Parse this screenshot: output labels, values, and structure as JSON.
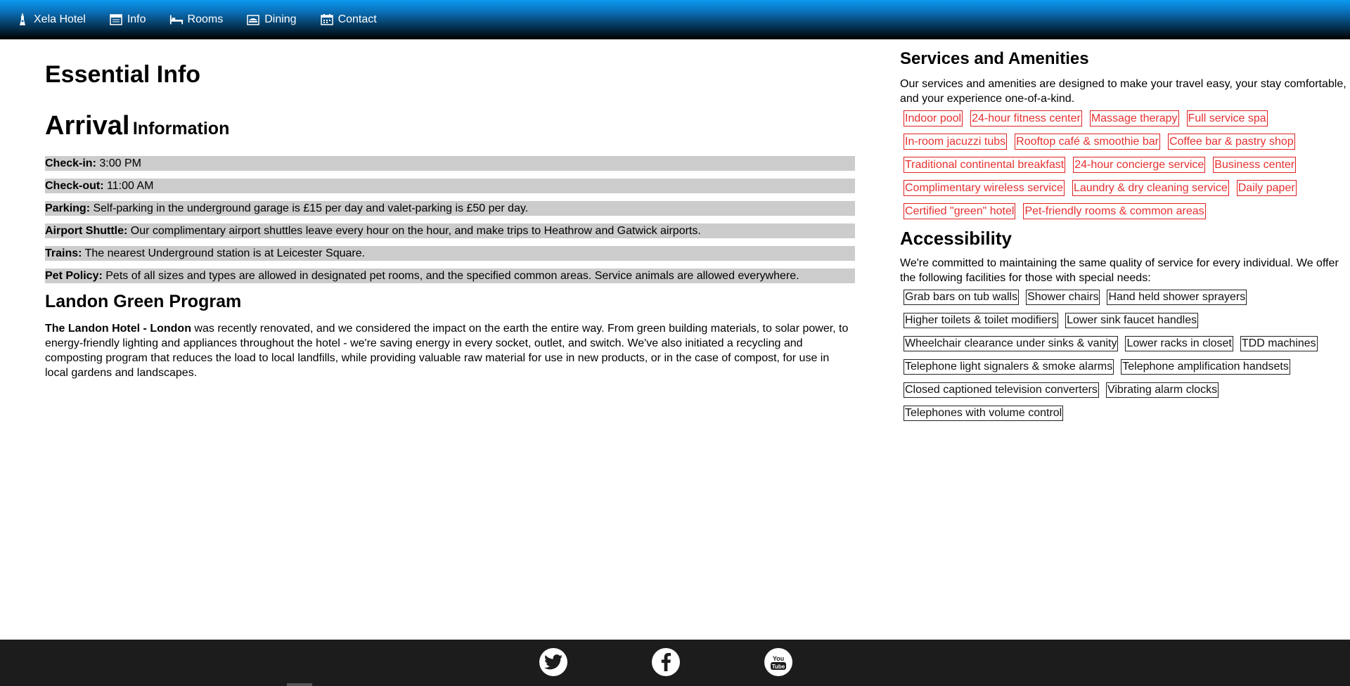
{
  "nav": {
    "brand": {
      "label": "Xela Hotel",
      "icon": "tower-icon"
    },
    "items": [
      {
        "label": "Info",
        "icon": "info-icon"
      },
      {
        "label": "Rooms",
        "icon": "bed-icon"
      },
      {
        "label": "Dining",
        "icon": "dining-icon"
      },
      {
        "label": "Contact",
        "icon": "contact-icon"
      }
    ]
  },
  "essential": {
    "title": "Essential Info",
    "arrival_big": "Arrival",
    "arrival_small": "Information",
    "rows": [
      {
        "label": "Check-in:",
        "text": " 3:00 PM"
      },
      {
        "label": "Check-out:",
        "text": " 11:00 AM"
      },
      {
        "label": "Parking:",
        "text": " Self-parking in the underground garage is £15 per day and valet-parking is £50 per day."
      },
      {
        "label": "Airport Shuttle:",
        "text": " Our complimentary airport shuttles leave every hour on the hour, and make trips to Heathrow and Gatwick airports."
      },
      {
        "label": "Trains:",
        "text": " The nearest Underground station is at Leicester Square."
      },
      {
        "label": "Pet Policy:",
        "text": " Pets of all sizes and types are allowed in designated pet rooms, and the specified common areas. Service animals are allowed everywhere."
      }
    ],
    "green_title": "Landon Green Program",
    "green_bold": "The Landon Hotel - London",
    "green_text": " was recently renovated, and we considered the impact on the earth the entire way. From green building materials, to solar power, to energy-friendly lighting and appliances throughout the hotel - we're saving energy in every socket, outlet, and switch. We've also initiated a recycling and composting program that reduces the load to local landfills, while providing valuable raw material for use in new products, or in the case of compost, for use in local gardens and landscapes."
  },
  "services": {
    "title": "Services and Amenities",
    "description": "Our services and amenities are designed to make your travel easy, your stay comfortable, and your experience one-of-a-kind.",
    "rows": [
      [
        "Indoor pool",
        "24-hour fitness center",
        "Massage therapy",
        "Full service spa"
      ],
      [
        "In-room jacuzzi tubs",
        "Rooftop café & smoothie bar",
        "Coffee bar & pastry shop"
      ],
      [
        "Traditional continental breakfast",
        "24-hour concierge service",
        "Business center"
      ],
      [
        "Complimentary wireless service",
        "Laundry & dry cleaning service",
        "Daily paper"
      ],
      [
        "Certified \"green\" hotel",
        "Pet-friendly rooms & common areas"
      ]
    ]
  },
  "accessibility": {
    "title": "Accessibility",
    "description": "We're committed to maintaining the same quality of service for every individual. We offer the following facilities for those with special needs:",
    "rows": [
      [
        "Grab bars on tub walls",
        "Shower chairs",
        "Hand held shower sprayers"
      ],
      [
        "Higher toilets & toilet modifiers",
        "Lower sink faucet handles"
      ],
      [
        "Wheelchair clearance under sinks & vanity",
        "Lower racks in closet",
        "TDD machines"
      ],
      [
        "Telephone light signalers & smoke alarms",
        "Telephone amplification handsets"
      ],
      [
        "Closed captioned television converters",
        "Vibrating alarm clocks"
      ],
      [
        "Telephones with volume control"
      ]
    ]
  },
  "footer": {
    "social": [
      {
        "name": "twitter-icon"
      },
      {
        "name": "facebook-icon"
      },
      {
        "name": "youtube-icon",
        "text": "You Tube"
      }
    ]
  },
  "colors": {
    "nav_top": "#0a9af0",
    "nav_bottom": "#000000",
    "row_bg": "#cccccc",
    "tag_red": "#e02020",
    "footer_bg": "#1c1c1c"
  }
}
